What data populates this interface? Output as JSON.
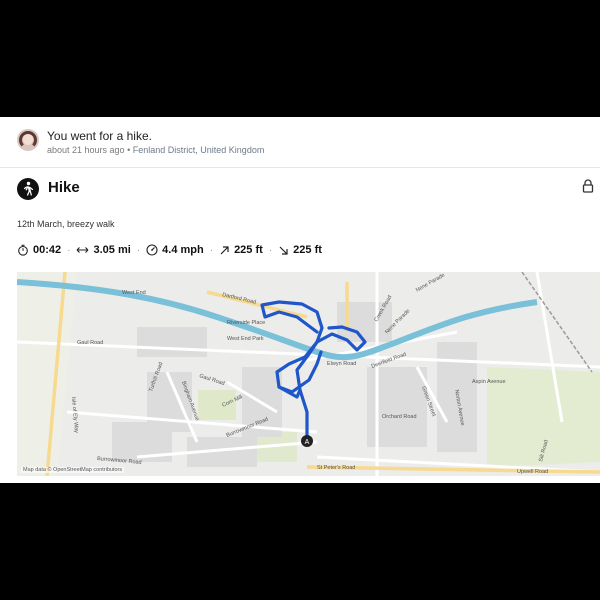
{
  "feed": {
    "title": "You went for a hike.",
    "time": "about 21 hours ago",
    "bullet": "•",
    "location": "Fenland District, United Kingdom"
  },
  "activity": {
    "icon": "hiker-icon",
    "title": "Hike",
    "description": "12th March, breezy walk",
    "stats": {
      "duration": "00:42",
      "distance": "3.05 mi",
      "speed": "4.4 mph",
      "ascent": "225 ft",
      "descent": "225 ft",
      "separator": "·"
    }
  },
  "map": {
    "attribution": "Map data © OpenStreetMap contributors",
    "marker_label": "A",
    "route_color": "#1f56c9",
    "river_color": "#79c0d8",
    "roads": {
      "west_end": "West End",
      "dartford": "Dartford Road",
      "riverside": "Riverside Place",
      "west_end_park": "West End Park",
      "gaul_road": "Gaul Road",
      "gaul_road_2": "Gaul Road",
      "turfhill": "Turfhill Road",
      "burrowmoor": "Burrowmoor Road",
      "burrowmoor_2": "Burrowmoor Road",
      "corn_mill": "Corn Mill",
      "elwyn": "Elwyn Road",
      "deerfield": "Deerfield Road",
      "creek": "Creek Road",
      "nene_parade": "Nene Parade",
      "nene_parade_2": "Nene Parade",
      "orchard": "Orchard Road",
      "green_street": "Green Street",
      "norton": "Norton Avenue",
      "aspin": "Aspin Avenue",
      "silt": "Silt Road",
      "upwell": "Upwell Road",
      "st_peters": "St Peter's Road",
      "isle_of_ely": "Isle of Ely Way",
      "bingham": "Bingham Avenue"
    }
  }
}
